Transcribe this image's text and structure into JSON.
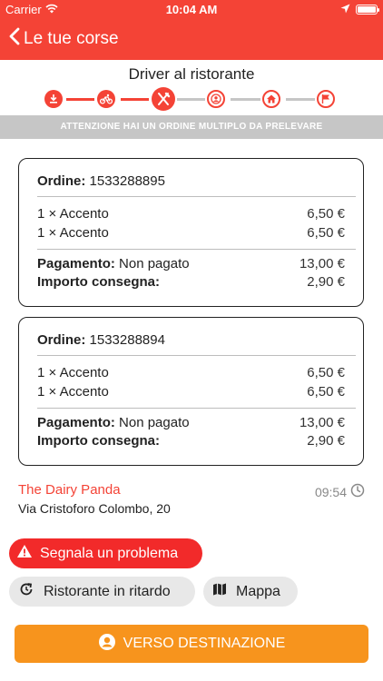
{
  "status_bar": {
    "carrier": "Carrier",
    "time": "10:04 AM"
  },
  "nav": {
    "back_label": "Le tue corse"
  },
  "header": {
    "title": "Driver al ristorante"
  },
  "stepper": {
    "steps": [
      "download-icon",
      "bike-icon",
      "cutlery-icon",
      "user-pin-icon",
      "home-icon",
      "flag-icon"
    ],
    "current_step": 3,
    "accent": "#f44336",
    "inactive": "#c6c6c6"
  },
  "banner": {
    "text": "ATTENZIONE HAI UN ORDINE MULTIPLO DA PRELEVARE"
  },
  "orders": [
    {
      "order_label": "Ordine:",
      "order_number": "1533288895",
      "items": [
        {
          "name": "1 × Accento",
          "price": "6,50 €"
        },
        {
          "name": "1 × Accento",
          "price": "6,50 €"
        }
      ],
      "payment_label": "Pagamento:",
      "payment_status": "Non pagato",
      "payment_amount": "13,00 €",
      "delivery_label": "Importo consegna:",
      "delivery_amount": "2,90 €"
    },
    {
      "order_label": "Ordine:",
      "order_number": "1533288894",
      "items": [
        {
          "name": "1 × Accento",
          "price": "6,50 €"
        },
        {
          "name": "1 × Accento",
          "price": "6,50 €"
        }
      ],
      "payment_label": "Pagamento:",
      "payment_status": "Non pagato",
      "payment_amount": "13,00 €",
      "delivery_label": "Importo consegna:",
      "delivery_amount": "2,90 €"
    }
  ],
  "restaurant": {
    "name": "The Dairy Panda",
    "address": "Via Cristoforo Colombo, 20",
    "time": "09:54"
  },
  "actions": {
    "problem_label": "Segnala un problema",
    "delay_label": "Ristorante in ritardo",
    "map_label": "Mappa",
    "main_label": "VERSO DESTINAZIONE"
  },
  "colors": {
    "accent": "#f44336",
    "primary_button": "#f7941d",
    "problem_button": "#f22a2a"
  }
}
